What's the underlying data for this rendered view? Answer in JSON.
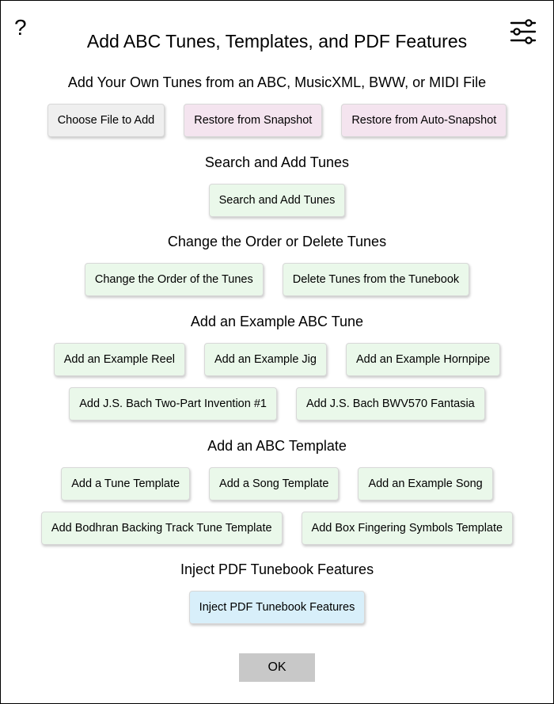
{
  "header": {
    "help_label": "?",
    "title": "Add ABC Tunes, Templates, and PDF Features",
    "settings_icon": "sliders-icon"
  },
  "sections": {
    "own_tunes": {
      "title": "Add Your Own Tunes from an ABC, MusicXML, BWW, or MIDI File",
      "choose_file": "Choose File to Add",
      "restore_snapshot": "Restore from Snapshot",
      "restore_auto_snapshot": "Restore from Auto-Snapshot"
    },
    "search": {
      "title": "Search and Add Tunes",
      "search_button": "Search and Add Tunes"
    },
    "order": {
      "title": "Change the Order or Delete Tunes",
      "change_order": "Change the Order of the Tunes",
      "delete_tunes": "Delete Tunes from the Tunebook"
    },
    "examples": {
      "title": "Add an Example ABC Tune",
      "reel": "Add an Example Reel",
      "jig": "Add an Example Jig",
      "hornpipe": "Add an Example Hornpipe",
      "bach_invention": "Add J.S. Bach Two-Part Invention #1",
      "bach_fantasia": "Add J.S. Bach BWV570 Fantasia"
    },
    "templates": {
      "title": "Add an ABC Template",
      "tune_template": "Add a Tune Template",
      "song_template": "Add a Song Template",
      "example_song": "Add an Example Song",
      "bodhran_template": "Add Bodhran Backing Track Tune Template",
      "box_fingering_template": "Add Box Fingering Symbols Template"
    },
    "pdf": {
      "title": "Inject PDF Tunebook Features",
      "inject_button": "Inject PDF Tunebook Features"
    }
  },
  "footer": {
    "ok_label": "OK"
  },
  "colors": {
    "gray_button": "#efefef",
    "pink_button": "#f4e4ef",
    "green_button": "#eaf8ea",
    "blue_button": "#d8effa",
    "ok_button": "#c8c8c8"
  }
}
